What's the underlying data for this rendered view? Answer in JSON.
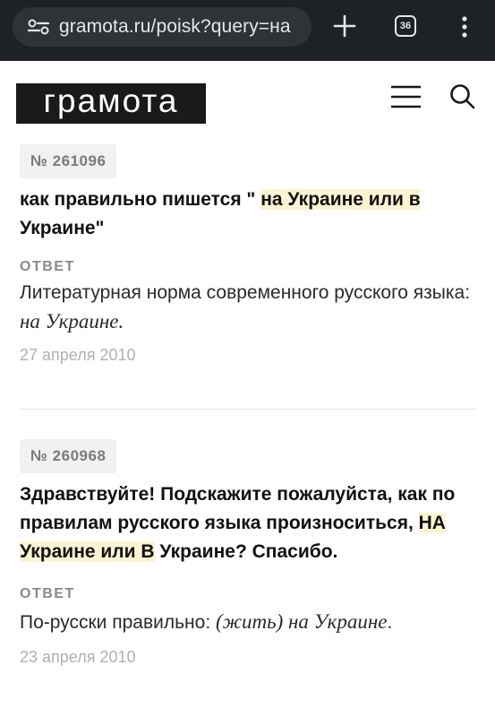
{
  "browser": {
    "url": "gramota.ru/poisk?query=на",
    "tab_count": "36"
  },
  "site": {
    "logo_text": "грамота"
  },
  "entries": [
    {
      "number": "№ 261096",
      "question_pre": "как правильно пишется \" ",
      "question_highlight": "на Украине или в",
      "question_post": " Украине\"",
      "answer_label": "ОТВЕТ",
      "answer_plain": "Литературная норма современного русского языка: ",
      "answer_italic": "на Украине.",
      "answer_plain_end": "",
      "date": "27 апреля 2010"
    },
    {
      "number": "№ 260968",
      "question_pre": "Здравствуйте! Подскажите пожалуйста, как по правилам русского языка произноситься, ",
      "question_highlight": "НА Украине или В",
      "question_post": " Украине? Спасибо.",
      "answer_label": "ОТВЕТ",
      "answer_plain": "По-русски правильно: ",
      "answer_italic": "(жить) на Украине",
      "answer_plain_end": ".",
      "date": "23 апреля 2010"
    }
  ]
}
